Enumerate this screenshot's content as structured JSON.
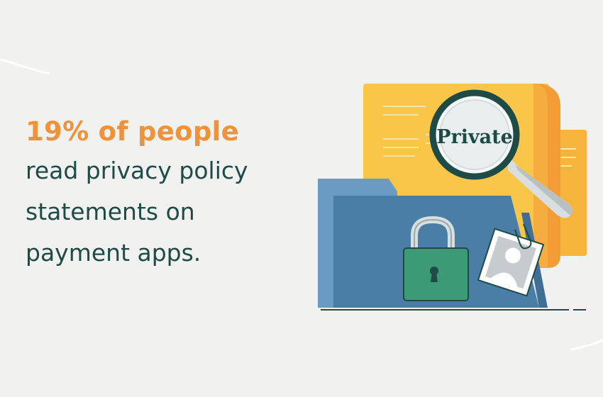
{
  "headline": {
    "stat": "19% of people",
    "lines": [
      "read privacy policy",
      "statements on",
      "payment apps."
    ]
  },
  "illustration": {
    "magnifier_label": "Private",
    "icons": [
      "document-icon",
      "magnifying-glass-icon",
      "folder-icon",
      "padlock-icon",
      "photo-icon",
      "paperclip-icon"
    ]
  },
  "colors": {
    "background": "#f1f1f0",
    "stat_text": "#f0923a",
    "body_text": "#1f4b47",
    "document_yellow": "#f9c64a",
    "document_orange": "#f49c35",
    "folder_blue": "#4b7ea6",
    "folder_tab": "#6a9bc2",
    "padlock_green": "#3c9a74",
    "padlock_shackle": "#d9dfe0",
    "magnifier_rim": "#1f4b47"
  }
}
